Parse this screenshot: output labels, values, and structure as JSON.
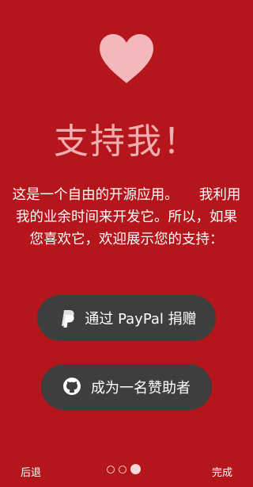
{
  "heart_color": "#f2b8bb",
  "background": "#b5161b",
  "title": "支持我！",
  "description": "这是一个自由的开源应用。　　我利用我的业余时间来开发它。所以，如果您喜欢它，欢迎展示您的支持：",
  "buttons": {
    "paypal": {
      "label": "通过 PayPal 捐赠",
      "icon": "paypal-icon"
    },
    "sponsor": {
      "label": "成为一名赞助者",
      "icon": "github-icon"
    }
  },
  "nav": {
    "back": "后退",
    "done": "完成",
    "page_count": 3,
    "current_page": 3
  }
}
